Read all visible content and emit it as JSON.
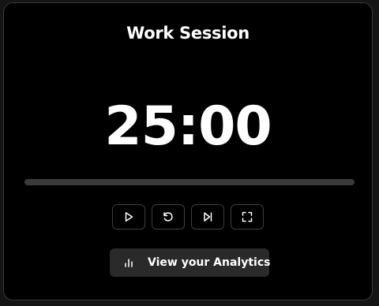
{
  "session": {
    "title": "Work Session",
    "time_display": "25:00",
    "progress_fraction": 0
  },
  "controls": [
    {
      "name": "play-button",
      "icon": "play-icon"
    },
    {
      "name": "reset-button",
      "icon": "rotate-ccw-icon"
    },
    {
      "name": "skip-button",
      "icon": "skip-forward-icon"
    },
    {
      "name": "fullscreen-button",
      "icon": "maximize-icon"
    }
  ],
  "analytics": {
    "label": "View your Analytics",
    "icon": "bar-chart-icon"
  },
  "colors": {
    "background": "#000000",
    "text": "#ffffff",
    "progress_track": "#3b3b3b",
    "analytics_button": "#2a2a2a",
    "border": "#3d3d3d"
  }
}
